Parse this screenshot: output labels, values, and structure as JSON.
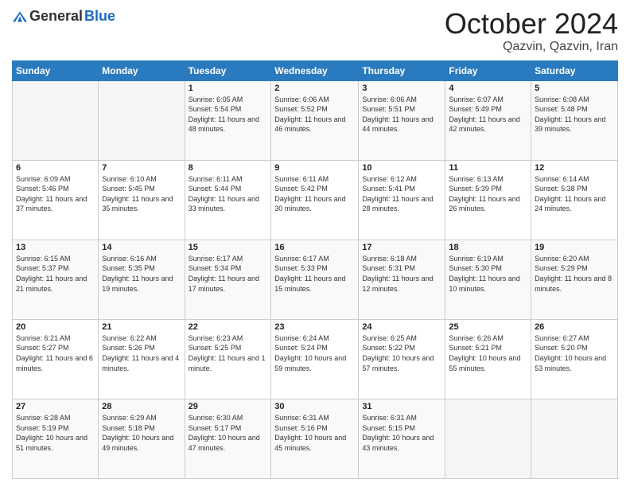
{
  "header": {
    "logo": {
      "general": "General",
      "blue": "Blue"
    },
    "title": "October 2024",
    "location": "Qazvin, Qazvin, Iran"
  },
  "weekdays": [
    "Sunday",
    "Monday",
    "Tuesday",
    "Wednesday",
    "Thursday",
    "Friday",
    "Saturday"
  ],
  "weeks": [
    [
      null,
      null,
      {
        "day": 1,
        "sunrise": "6:05 AM",
        "sunset": "5:54 PM",
        "daylight": "11 hours and 48 minutes."
      },
      {
        "day": 2,
        "sunrise": "6:06 AM",
        "sunset": "5:52 PM",
        "daylight": "11 hours and 46 minutes."
      },
      {
        "day": 3,
        "sunrise": "6:06 AM",
        "sunset": "5:51 PM",
        "daylight": "11 hours and 44 minutes."
      },
      {
        "day": 4,
        "sunrise": "6:07 AM",
        "sunset": "5:49 PM",
        "daylight": "11 hours and 42 minutes."
      },
      {
        "day": 5,
        "sunrise": "6:08 AM",
        "sunset": "5:48 PM",
        "daylight": "11 hours and 39 minutes."
      }
    ],
    [
      {
        "day": 6,
        "sunrise": "6:09 AM",
        "sunset": "5:46 PM",
        "daylight": "11 hours and 37 minutes."
      },
      {
        "day": 7,
        "sunrise": "6:10 AM",
        "sunset": "5:45 PM",
        "daylight": "11 hours and 35 minutes."
      },
      {
        "day": 8,
        "sunrise": "6:11 AM",
        "sunset": "5:44 PM",
        "daylight": "11 hours and 33 minutes."
      },
      {
        "day": 9,
        "sunrise": "6:11 AM",
        "sunset": "5:42 PM",
        "daylight": "11 hours and 30 minutes."
      },
      {
        "day": 10,
        "sunrise": "6:12 AM",
        "sunset": "5:41 PM",
        "daylight": "11 hours and 28 minutes."
      },
      {
        "day": 11,
        "sunrise": "6:13 AM",
        "sunset": "5:39 PM",
        "daylight": "11 hours and 26 minutes."
      },
      {
        "day": 12,
        "sunrise": "6:14 AM",
        "sunset": "5:38 PM",
        "daylight": "11 hours and 24 minutes."
      }
    ],
    [
      {
        "day": 13,
        "sunrise": "6:15 AM",
        "sunset": "5:37 PM",
        "daylight": "11 hours and 21 minutes."
      },
      {
        "day": 14,
        "sunrise": "6:16 AM",
        "sunset": "5:35 PM",
        "daylight": "11 hours and 19 minutes."
      },
      {
        "day": 15,
        "sunrise": "6:17 AM",
        "sunset": "5:34 PM",
        "daylight": "11 hours and 17 minutes."
      },
      {
        "day": 16,
        "sunrise": "6:17 AM",
        "sunset": "5:33 PM",
        "daylight": "11 hours and 15 minutes."
      },
      {
        "day": 17,
        "sunrise": "6:18 AM",
        "sunset": "5:31 PM",
        "daylight": "11 hours and 12 minutes."
      },
      {
        "day": 18,
        "sunrise": "6:19 AM",
        "sunset": "5:30 PM",
        "daylight": "11 hours and 10 minutes."
      },
      {
        "day": 19,
        "sunrise": "6:20 AM",
        "sunset": "5:29 PM",
        "daylight": "11 hours and 8 minutes."
      }
    ],
    [
      {
        "day": 20,
        "sunrise": "6:21 AM",
        "sunset": "5:27 PM",
        "daylight": "11 hours and 6 minutes."
      },
      {
        "day": 21,
        "sunrise": "6:22 AM",
        "sunset": "5:26 PM",
        "daylight": "11 hours and 4 minutes."
      },
      {
        "day": 22,
        "sunrise": "6:23 AM",
        "sunset": "5:25 PM",
        "daylight": "11 hours and 1 minute."
      },
      {
        "day": 23,
        "sunrise": "6:24 AM",
        "sunset": "5:24 PM",
        "daylight": "10 hours and 59 minutes."
      },
      {
        "day": 24,
        "sunrise": "6:25 AM",
        "sunset": "5:22 PM",
        "daylight": "10 hours and 57 minutes."
      },
      {
        "day": 25,
        "sunrise": "6:26 AM",
        "sunset": "5:21 PM",
        "daylight": "10 hours and 55 minutes."
      },
      {
        "day": 26,
        "sunrise": "6:27 AM",
        "sunset": "5:20 PM",
        "daylight": "10 hours and 53 minutes."
      }
    ],
    [
      {
        "day": 27,
        "sunrise": "6:28 AM",
        "sunset": "5:19 PM",
        "daylight": "10 hours and 51 minutes."
      },
      {
        "day": 28,
        "sunrise": "6:29 AM",
        "sunset": "5:18 PM",
        "daylight": "10 hours and 49 minutes."
      },
      {
        "day": 29,
        "sunrise": "6:30 AM",
        "sunset": "5:17 PM",
        "daylight": "10 hours and 47 minutes."
      },
      {
        "day": 30,
        "sunrise": "6:31 AM",
        "sunset": "5:16 PM",
        "daylight": "10 hours and 45 minutes."
      },
      {
        "day": 31,
        "sunrise": "6:31 AM",
        "sunset": "5:15 PM",
        "daylight": "10 hours and 43 minutes."
      },
      null,
      null
    ]
  ]
}
